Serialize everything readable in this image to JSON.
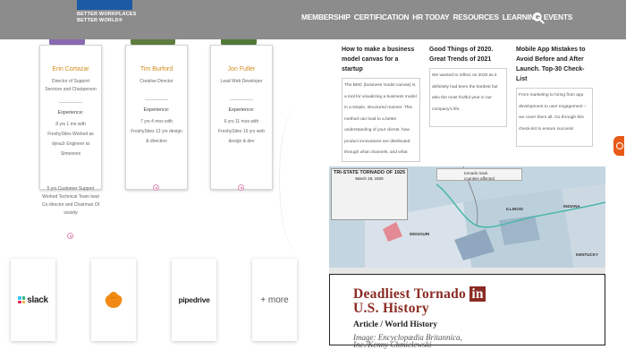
{
  "header": {
    "logo_lines": [
      "BETTER WORKPLACES",
      "BETTER WORLD®"
    ],
    "nav": [
      "MEMBERSHIP",
      "CERTIFICATION",
      "HR TODAY",
      "RESOURCES",
      "LEARNING",
      "EVENTS"
    ],
    "search_icon": "search-icon"
  },
  "profiles": [
    {
      "name": "Erin Cortazar",
      "role": "Director of Support Services and Chairperson",
      "experience_label": "Experience:",
      "experience": "8 yrs 1 mo with FreshySites Worked as dynaJr Engineer at Simeonex",
      "experience_overflow": "5 yrs Customer Support Worked Technical Team lead Co-director and Chairman Of society"
    },
    {
      "name": "Tim Burford",
      "role": "Creative Director",
      "experience_label": "Experience:",
      "experience": "7 yrs 4 mos with FreshySites 12 yrs design & direction"
    },
    {
      "name": "Jon Fuller",
      "role": "Lead Web Developer",
      "experience_label": "Experience:",
      "experience": "6 yrs 11 mos with FreshySites 16 yrs web design & dev"
    }
  ],
  "partner_logos": [
    {
      "name": "slack",
      "label": "slack"
    },
    {
      "name": "orange-blob",
      "label": ""
    },
    {
      "name": "pipedrive",
      "label": "pipedrive"
    },
    {
      "name": "more",
      "label": "+ more"
    }
  ],
  "blog_cards": [
    {
      "title": "How to make a business model canvas for a startup",
      "excerpt": "The BMC (business model canvas) is a tool for visualizing a business model in a simple, structured manner. This method can lead to a better understanding of your clients, how product innovations are distributed through what channels, and what brings the most profit."
    },
    {
      "title": "Good Things of 2020. Great Trends of 2021",
      "excerpt": "We wanted to reflect on 2020 as it definitely had been the hardest but also the most fruitful year in our company's life."
    },
    {
      "title": "Mobile App Mistakes to Avoid Before and After Launch. Top-30 Check-List",
      "excerpt": "From marketing to hiring from app development to user engagement – we cover them all. Go through this check-list to ensure success!"
    }
  ],
  "map": {
    "table_title": "TRI-STATE TORNADO OF 1925",
    "table_subtitle": "March 18, 1925",
    "legend_items": [
      "tornado track",
      "counties affected"
    ],
    "states": [
      "MISSOURI",
      "ILLINOIS",
      "INDIANA",
      "KENTUCKY"
    ]
  },
  "article": {
    "title_part1": "Deadliest Tornado",
    "title_in": "in",
    "title_part2": "U.S. History",
    "category": "Article / World History",
    "credit_line1": "Image: Encyclopædia Britannica,",
    "credit_line2": "Inc./Kenny Chmielewski"
  },
  "colors": {
    "header_bg": "#8c8c8c",
    "accent_orange": "#d18c1c",
    "article_red": "#8b2b23",
    "fab_orange": "#e85a18"
  }
}
